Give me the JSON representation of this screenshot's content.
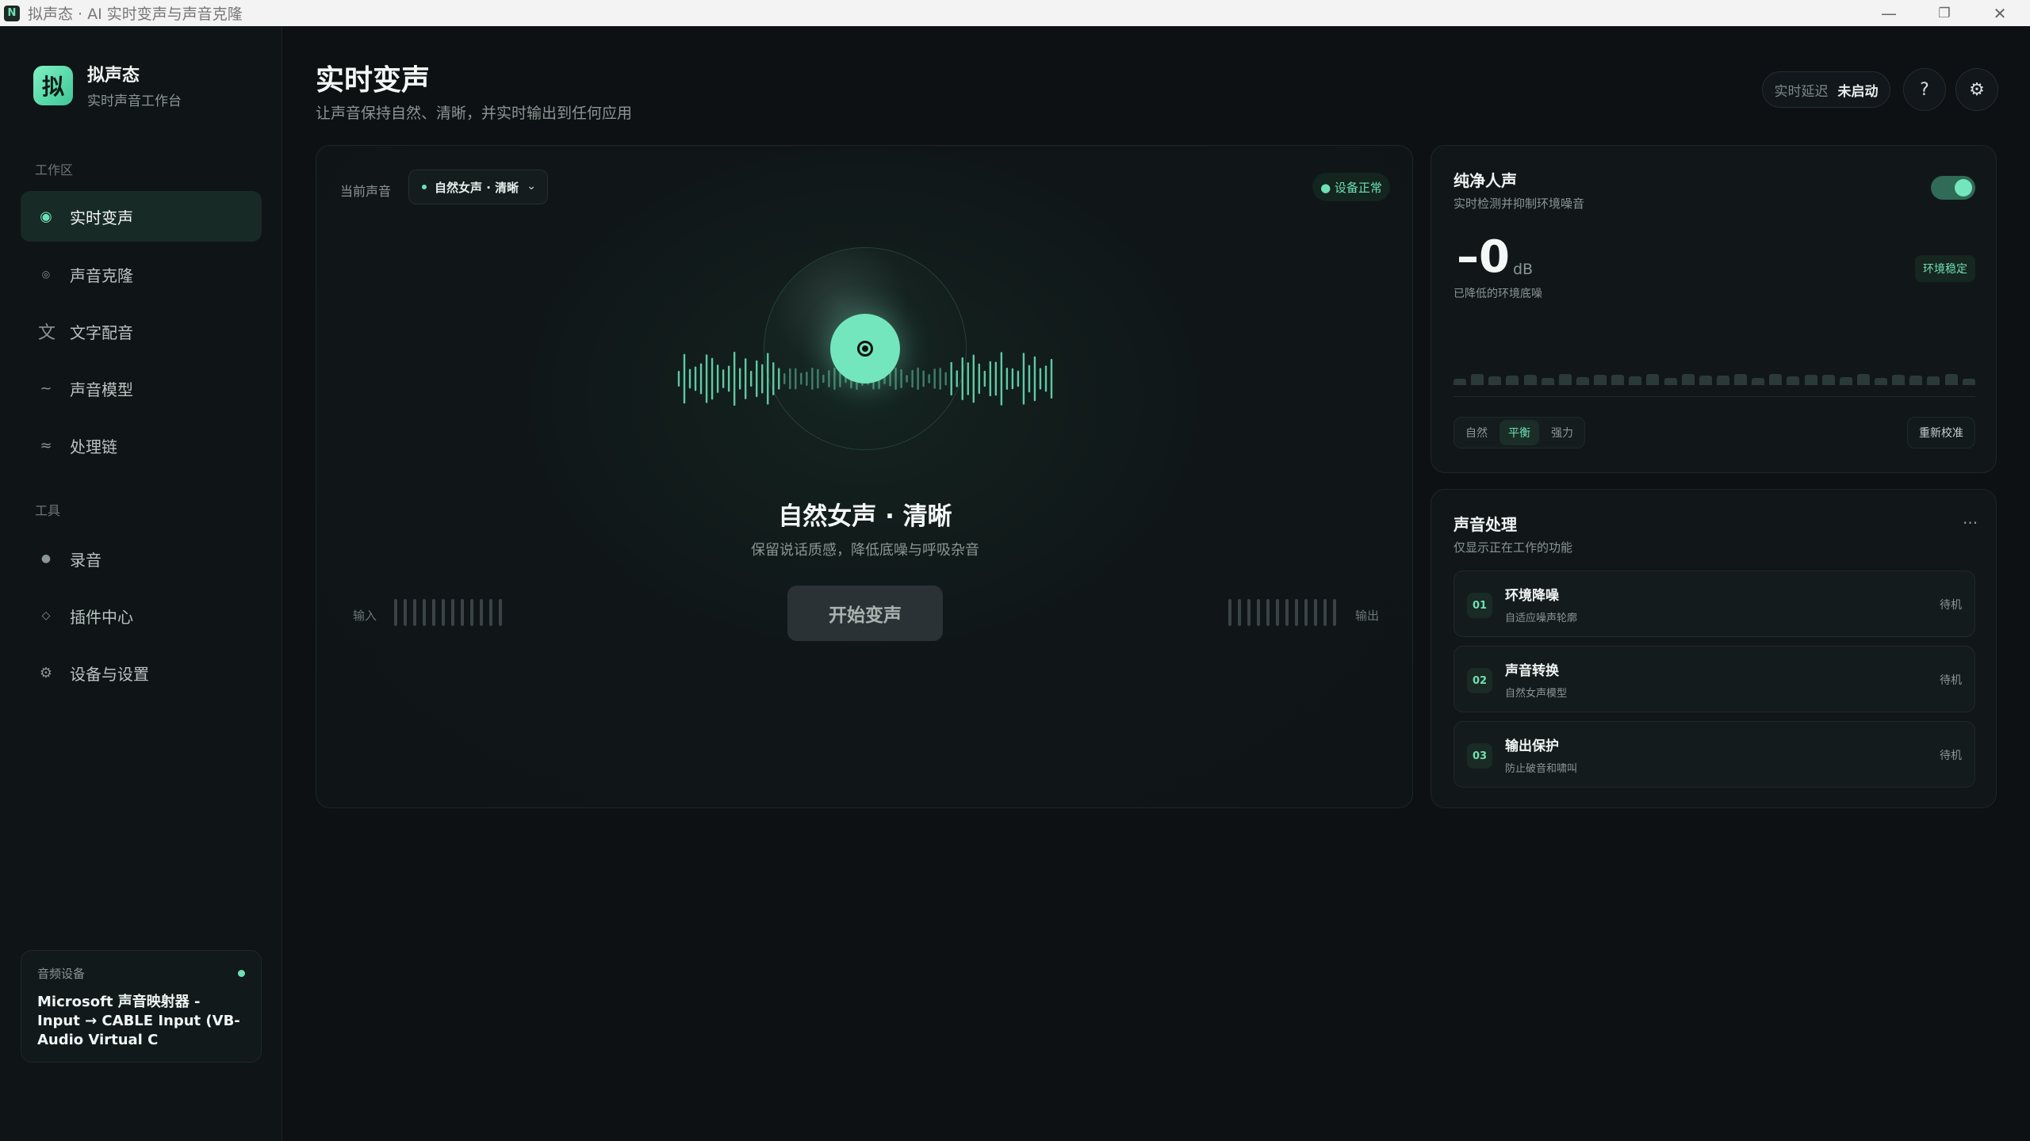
{
  "window": {
    "title": "拟声态 · AI 实时变声与声音克隆",
    "icon_letter": "N"
  },
  "brand": {
    "logo": "拟",
    "name": "拟声态",
    "subtitle": "实时声音工作台"
  },
  "sidebar": {
    "section_workspace": "工作区",
    "section_tools": "工具",
    "workspace_items": [
      {
        "label": "实时变声",
        "icon": "target-icon",
        "active": true
      },
      {
        "label": "声音克隆",
        "icon": "dot-icon"
      },
      {
        "label": "文字配音",
        "icon": "text-icon"
      },
      {
        "label": "声音模型",
        "icon": "wave-icon"
      },
      {
        "label": "处理链",
        "icon": "chain-icon"
      }
    ],
    "tool_items": [
      {
        "label": "录音",
        "icon": "record-icon"
      },
      {
        "label": "插件中心",
        "icon": "diamond-icon"
      },
      {
        "label": "设备与设置",
        "icon": "gear-icon"
      }
    ],
    "device": {
      "label": "音频设备",
      "name": "Microsoft 声音映射器 - Input → CABLE Input (VB-Audio Virtual C"
    }
  },
  "header": {
    "title": "实时变声",
    "subtitle": "让声音保持自然、清晰，并实时输出到任何应用",
    "latency_label": "实时延迟",
    "latency_value": "未启动",
    "help": "?",
    "settings": "⚙"
  },
  "main": {
    "current_voice_label": "当前声音",
    "current_voice": "自然女声 · 清晰",
    "device_status": "● 设备正常",
    "voice_title": "自然女声 · 清晰",
    "voice_desc": "保留说话质感，降低底噪与呼吸杂音",
    "start_button": "开始变声",
    "input_label": "输入",
    "output_label": "输出"
  },
  "noise_panel": {
    "title": "纯净人声",
    "subtitle": "实时检测并抑制环境噪音",
    "toggle_on": true,
    "db_value": "–0",
    "db_unit": "dB",
    "db_note": "已降低的环境底噪",
    "env_status": "环境稳定",
    "modes": [
      "自然",
      "平衡",
      "强力"
    ],
    "active_mode": "平衡",
    "recalibrate": "重新校准"
  },
  "processing": {
    "title": "声音处理",
    "subtitle": "仅显示正在工作的功能",
    "more": "···",
    "steps": [
      {
        "num": "01",
        "name": "环境降噪",
        "desc": "自适应噪声轮廓",
        "status": "待机"
      },
      {
        "num": "02",
        "name": "声音转换",
        "desc": "自然女声模型",
        "status": "待机"
      },
      {
        "num": "03",
        "name": "输出保护",
        "desc": "防止破音和啸叫",
        "status": "待机"
      }
    ]
  },
  "colors": {
    "accent": "#6ee0b5",
    "background": "#0d1113",
    "card": "#111719"
  }
}
